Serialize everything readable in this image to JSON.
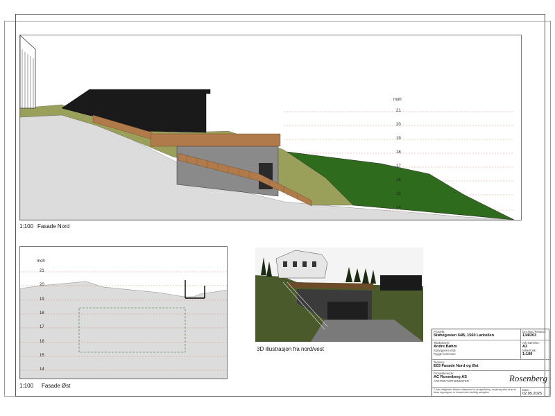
{
  "facade_north": {
    "scale": "1:100",
    "title": "Fasade Nord",
    "moh_label": "moh",
    "ticks": [
      "21",
      "20",
      "19",
      "18",
      "17",
      "16",
      "15",
      "14"
    ]
  },
  "facade_east": {
    "scale": "1:100",
    "title": "Fasade Øst",
    "moh_label": "moh",
    "ticks": [
      "21",
      "20",
      "19",
      "18",
      "17",
      "16",
      "15",
      "14"
    ]
  },
  "illustration": {
    "caption": "3D illustrasjon fra nord/vest"
  },
  "title_block": {
    "project_label": "Prosjekt:",
    "project_value": "Støtvigveien 64B, 1560 Larkollen",
    "gnr_label": "Gnr./Bnr./Festenr.:",
    "gnr_value": "134/203",
    "client_label": "Tiltakshaver:",
    "client_name": "Andre Bøhm",
    "client_address": "Støtvigveien 64B",
    "client_municipality": "Rygge kommune",
    "sheet_size_label": "Ark størrelse:",
    "sheet_size_value": "A3",
    "scale_label": "Målestokk:",
    "scale_value": "1:100",
    "drawing_label": "Tegning:",
    "drawing_value": "E03 Fasade Nord og Øst",
    "designer_label": "Prosjekterende:",
    "designer_value": "AC Rosenberg AS",
    "designer_sub": "ARKITEKTURTJENESTER",
    "logo_text": "Rosenberg",
    "rights_note": "© Alle rettigheter tilhører utførende for prosjektering. kopiering eller bruk av disse tegningene er forbudt uten skriftlig samtykke",
    "date_label": "Dato:",
    "date_value": "02.05.2025"
  },
  "colors": {
    "ground": "#dcdcdc",
    "grass_light": "#9aa05a",
    "grass_dark": "#2f6b1d",
    "wood": "#b07a4a",
    "building_dark": "#1a1a1a",
    "concrete": "#8a8a8a",
    "level_line": "#d98a7a"
  }
}
